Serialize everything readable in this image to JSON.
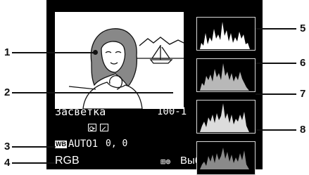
{
  "callouts": [
    "1",
    "2",
    "3",
    "4",
    "5",
    "6",
    "7",
    "8"
  ],
  "photo": {
    "label": "Засветка",
    "frame_number": "100-1"
  },
  "wb": {
    "badge": "WB",
    "value": "AUTO1",
    "adjust": "0, 0"
  },
  "bottom": {
    "mode": "RGB",
    "hint_icon": "⊞⊕",
    "hint_text": "Выбрать R,G,B"
  },
  "icons": [
    "protect-icon",
    "retouch-icon"
  ],
  "histograms": [
    {
      "name": "luminance",
      "color": "#ffffff"
    },
    {
      "name": "red",
      "color": "#b8b8b8"
    },
    {
      "name": "green",
      "color": "#dcdcdc"
    },
    {
      "name": "blue",
      "color": "#8a8a8a"
    }
  ]
}
